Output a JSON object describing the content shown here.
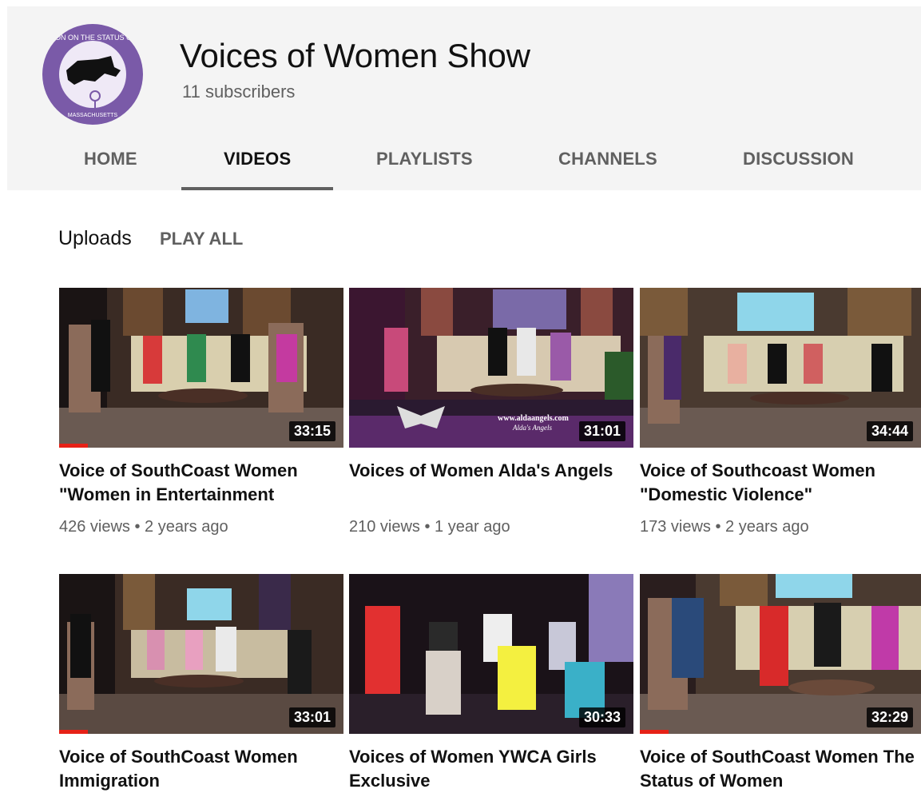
{
  "channel": {
    "title": "Voices of Women Show",
    "subscribers": "11 subscribers",
    "logo_text_top": "COMMISSION ON THE STATUS OF WOMEN",
    "logo_text_bottom": "MASSACHUSETTS"
  },
  "tabs": [
    {
      "label": "HOME",
      "active": false
    },
    {
      "label": "VIDEOS",
      "active": true
    },
    {
      "label": "PLAYLISTS",
      "active": false
    },
    {
      "label": "CHANNELS",
      "active": false
    },
    {
      "label": "DISCUSSION",
      "active": false
    }
  ],
  "section": {
    "title": "Uploads",
    "play_all": "PLAY ALL"
  },
  "videos": [
    {
      "title": "Voice of SouthCoast Women \"Women in Entertainment",
      "meta": "426 views • 2 years ago",
      "duration": "33:15",
      "watched": 0.1
    },
    {
      "title": "Voices of Women Alda's Angels",
      "meta": "210 views • 1 year ago",
      "duration": "31:01",
      "watched": 0,
      "overlay_url": "www.aldaangels.com",
      "overlay_name": "Alda's Angels"
    },
    {
      "title": "Voice of Southcoast Women \"Domestic Violence\"",
      "meta": "173 views • 2 years ago",
      "duration": "34:44",
      "watched": 0
    },
    {
      "title": "Voice of SouthCoast Women Immigration",
      "meta": "",
      "duration": "33:01",
      "watched": 0.1
    },
    {
      "title": "Voices of Women YWCA Girls Exclusive",
      "meta": "",
      "duration": "30:33",
      "watched": 0
    },
    {
      "title": "Voice of SouthCoast Women The Status of Women",
      "meta": "",
      "duration": "32:29",
      "watched": 0.1
    }
  ],
  "colors": {
    "accent_red": "#e62117",
    "logo_purple": "#7a5aa8"
  }
}
